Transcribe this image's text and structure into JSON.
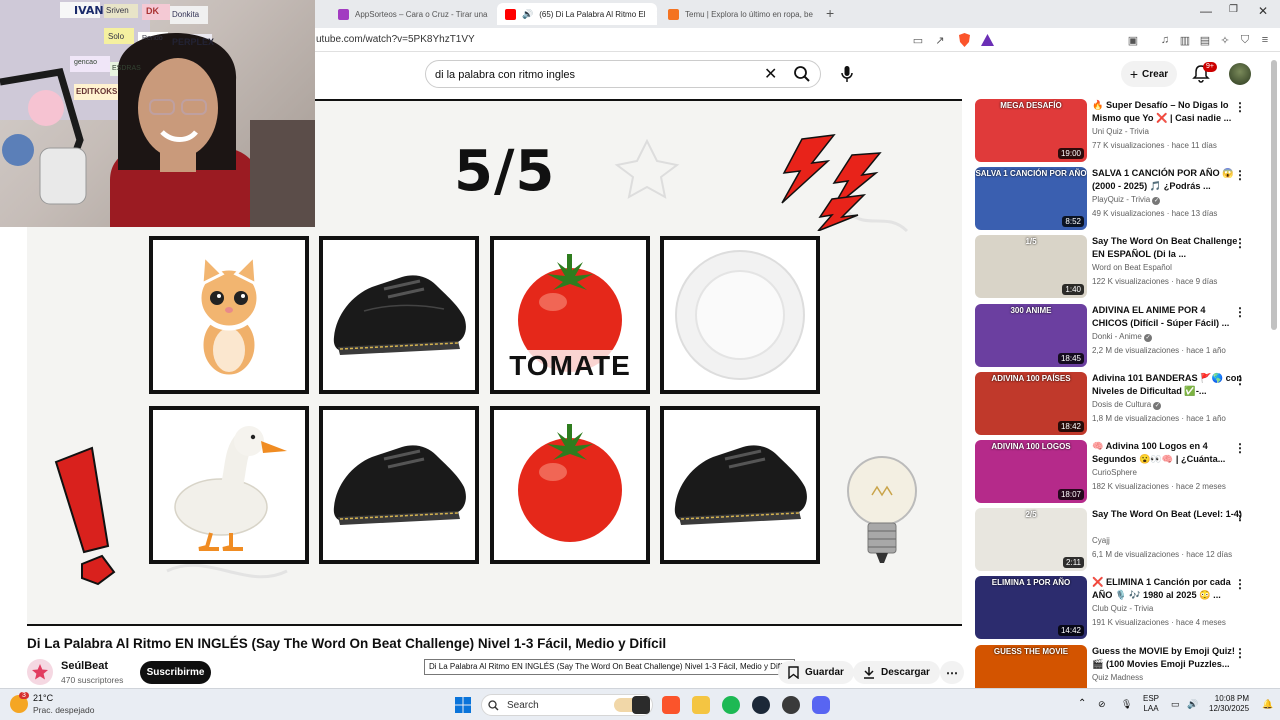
{
  "browser": {
    "tabs": [
      {
        "label": "AppSorteos – Cara o Cruz - Tirar una",
        "icon": "appsorteos-icon",
        "active": false
      },
      {
        "label": "(65) Di La Palabra Al Ritmo El",
        "icon": "youtube-icon",
        "active": true
      },
      {
        "label": "Temu | Explora lo último en ropa, be",
        "icon": "temu-icon",
        "active": false
      }
    ],
    "url": "utube.com/watch?v=5PK8YhzT1VY"
  },
  "header": {
    "search_value": "di la palabra con ritmo ingles",
    "create_label": "Crear",
    "notifications_badge": "9+"
  },
  "player": {
    "counter": "5/5",
    "cards": [
      {
        "name": "cat",
        "label": ""
      },
      {
        "name": "shoe",
        "label": ""
      },
      {
        "name": "tomato",
        "label": "TOMATE"
      },
      {
        "name": "plate",
        "label": ""
      },
      {
        "name": "duck",
        "label": ""
      },
      {
        "name": "shoe",
        "label": ""
      },
      {
        "name": "tomato",
        "label": ""
      },
      {
        "name": "shoe",
        "label": ""
      }
    ]
  },
  "webcam": {
    "wall_labels": [
      "IVAN",
      "Sriven",
      "DK",
      "Donkita",
      "Solo",
      "Rendo",
      "PERPLEX",
      "EDITKOKS",
      "ESDRAS",
      "gencao"
    ]
  },
  "video": {
    "title": "Di La Palabra Al Ritmo EN INGLÉS (Say The Word On Beat Challenge) Nivel 1-3 Fácil, Medio y Difícil",
    "channel": "SeúlBeat",
    "subscribers": "470 suscriptores",
    "subscribe_label": "Suscribirme",
    "tooltip": "Di La Palabra Al Ritmo EN INGLÉS (Say The Word On Beat Challenge) Nivel 1-3 Fácil, Medio y Difícil",
    "save_label": "Guardar",
    "download_label": "Descargar"
  },
  "recommendations": [
    {
      "thumb_text": "MEGA DESAFÍO",
      "thumb_color": "#e03a3a",
      "duration": "19:00",
      "title": "🔥 Super Desafío – No Digas lo Mismo que Yo ❌ | Casi nadie ...",
      "channel": "Uni Quiz - Trivia",
      "meta": "77 K visualizaciones · hace 11 días",
      "verified": false
    },
    {
      "thumb_text": "SALVA 1 CANCIÓN POR AÑO",
      "thumb_color": "#3a5fb0",
      "duration": "8:52",
      "title": "SALVA 1 CANCIÓN POR AÑO 😱 (2000 - 2025) 🎵 ¿Podrás ...",
      "channel": "PlayQuiz - Trivia",
      "meta": "49 K visualizaciones · hace 13 días",
      "verified": true
    },
    {
      "thumb_text": "1/5",
      "thumb_color": "#d9d4c8",
      "duration": "1:40",
      "title": "Say The Word On Beat Challenge EN ESPAÑOL (Di la ...",
      "channel": "Word on Beat Español",
      "meta": "122 K visualizaciones · hace 9 días",
      "verified": false
    },
    {
      "thumb_text": "300 ANIME",
      "thumb_color": "#6b3fa0",
      "duration": "18:45",
      "title": "ADIVINA EL ANIME POR 4 CHICOS (Difícil - Súper Fácil) ...",
      "channel": "Donki - Anime",
      "meta": "2,2 M de visualizaciones · hace 1 año",
      "verified": true
    },
    {
      "thumb_text": "ADIVINA 100 PAÍSES",
      "thumb_color": "#c0392b",
      "duration": "18:42",
      "title": "Adivina 101 BANDERAS 🚩🌎 con Niveles de Dificultad ✅-...",
      "channel": "Dosis de Cultura",
      "meta": "1,8 M de visualizaciones · hace 1 año",
      "verified": true
    },
    {
      "thumb_text": "ADIVINA 100 LOGOS",
      "thumb_color": "#b52a8a",
      "duration": "18:07",
      "title": "🧠 Adivina 100 Logos en 4 Segundos 😮👀🧠 | ¿Cuánta...",
      "channel": "CurioSphere",
      "meta": "182 K visualizaciones · hace 2 meses",
      "verified": false
    },
    {
      "thumb_text": "2/5",
      "thumb_color": "#e8e6df",
      "duration": "2:11",
      "title": "Say The Word On Beat (Level: 1-4)",
      "channel": "Cyajj",
      "meta": "6,1 M de visualizaciones · hace 12 días",
      "verified": false
    },
    {
      "thumb_text": "ELIMINA 1 POR AÑO",
      "thumb_color": "#2c2c6e",
      "duration": "14:42",
      "title": "❌ ELIMINA 1 Canción por cada AÑO 🎙️ 🎶 1980 al 2025 😳 ...",
      "channel": "Club Quiz - Trivia",
      "meta": "191 K visualizaciones · hace 4 meses",
      "verified": false
    },
    {
      "thumb_text": "GUESS THE MOVIE",
      "thumb_color": "#d35400",
      "duration": "",
      "title": "Guess the MOVIE by Emoji Quiz! 🎬 (100 Movies Emoji Puzzles...",
      "channel": "Quiz Madness",
      "meta": "",
      "verified": false
    }
  ],
  "taskbar": {
    "weather_badge": "3",
    "temperature": "21°C",
    "weather_desc": "Prac. despejado",
    "search_placeholder": "Search",
    "lang_1": "ESP",
    "lang_2": "LAA",
    "time": "10:08 PM",
    "date": "12/30/2025"
  },
  "colors": {
    "yt_red": "#ff0000",
    "subscribe_bg": "#0f0f0f",
    "taskbar_bg": "#e9edf3",
    "tomato_red": "#e5281a"
  }
}
